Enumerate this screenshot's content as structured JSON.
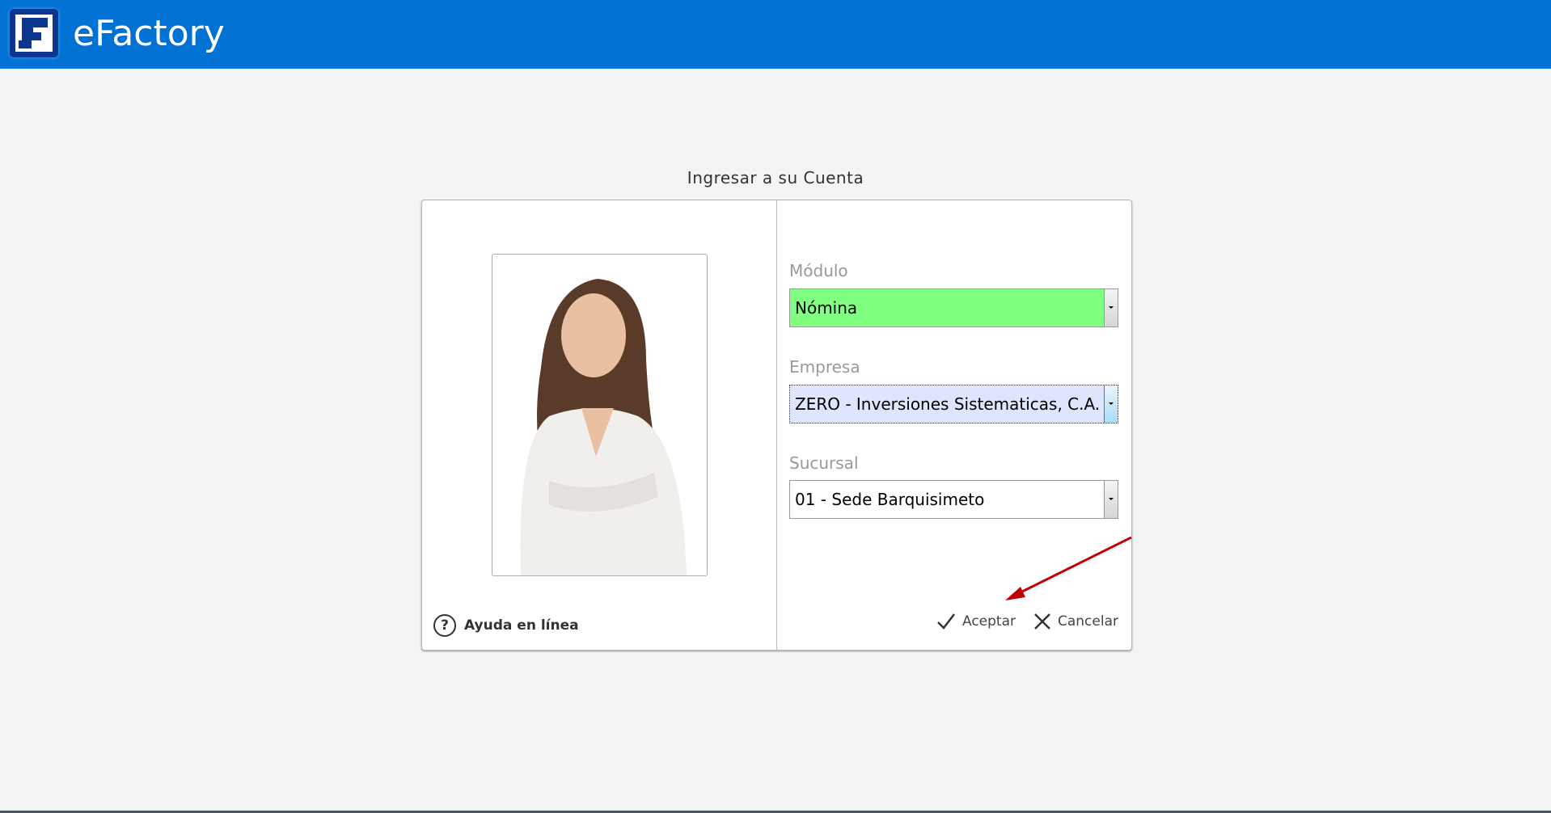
{
  "header": {
    "app_title": "eFactory",
    "logo_icon": "efactory-logo"
  },
  "page": {
    "title": "Ingresar a su Cuenta"
  },
  "form": {
    "modulo": {
      "label": "Módulo",
      "value": "Nómina",
      "bg": "#80ff80"
    },
    "empresa": {
      "label": "Empresa",
      "value": "ZERO - Inversiones Sistematicas, C.A.",
      "bg": "#dfe5fc"
    },
    "sucursal": {
      "label": "Sucursal",
      "value": "01 - Sede Barquisimeto"
    }
  },
  "help": {
    "label": "Ayuda en línea",
    "icon": "question-circle-icon"
  },
  "actions": {
    "accept": "Aceptar",
    "cancel": "Cancelar"
  },
  "colors": {
    "header": "#0172d4",
    "annotation_arrow": "#c00000"
  }
}
